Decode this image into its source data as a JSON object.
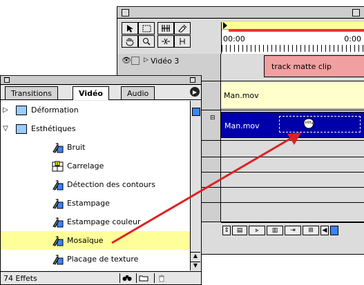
{
  "timeline": {
    "ruler": {
      "timecode_start": "00:00",
      "timecode_end": "0:00"
    },
    "tracks": [
      {
        "name": "Vidéo 3",
        "clip_label": "track matte clip"
      },
      {
        "clip_label": "Man.mov"
      },
      {
        "clip_label": "Man.mov"
      }
    ]
  },
  "effects_palette": {
    "tabs": [
      {
        "label": "Transitions"
      },
      {
        "label": "Vidéo"
      },
      {
        "label": "Audio"
      }
    ],
    "folders": [
      {
        "label": "Déformation",
        "expanded": false
      },
      {
        "label": "Esthétiques",
        "expanded": true
      }
    ],
    "effects": [
      {
        "label": "Bruit"
      },
      {
        "label": "Carrelage"
      },
      {
        "label": "Détection des contours"
      },
      {
        "label": "Estampage"
      },
      {
        "label": "Estampage couleur"
      },
      {
        "label": "Mosaïque",
        "selected": true
      },
      {
        "label": "Placage de texture"
      }
    ],
    "count": "74 Effets"
  },
  "colors": {
    "track_matte_clip": "#f0a0a0",
    "yellow_clip": "#ffffcc",
    "blue_clip": "#0000aa",
    "selection": "#ffff99",
    "arrow": "#e02020"
  },
  "icons": {
    "tools": [
      "arrow-select-icon",
      "marquee-icon",
      "track-select-icon",
      "razor-icon",
      "hand-icon",
      "zoom-icon",
      "link-icon",
      "edit-in-out-icon"
    ],
    "footer": [
      "binoculars-icon",
      "new-folder-icon",
      "trash-icon"
    ]
  }
}
